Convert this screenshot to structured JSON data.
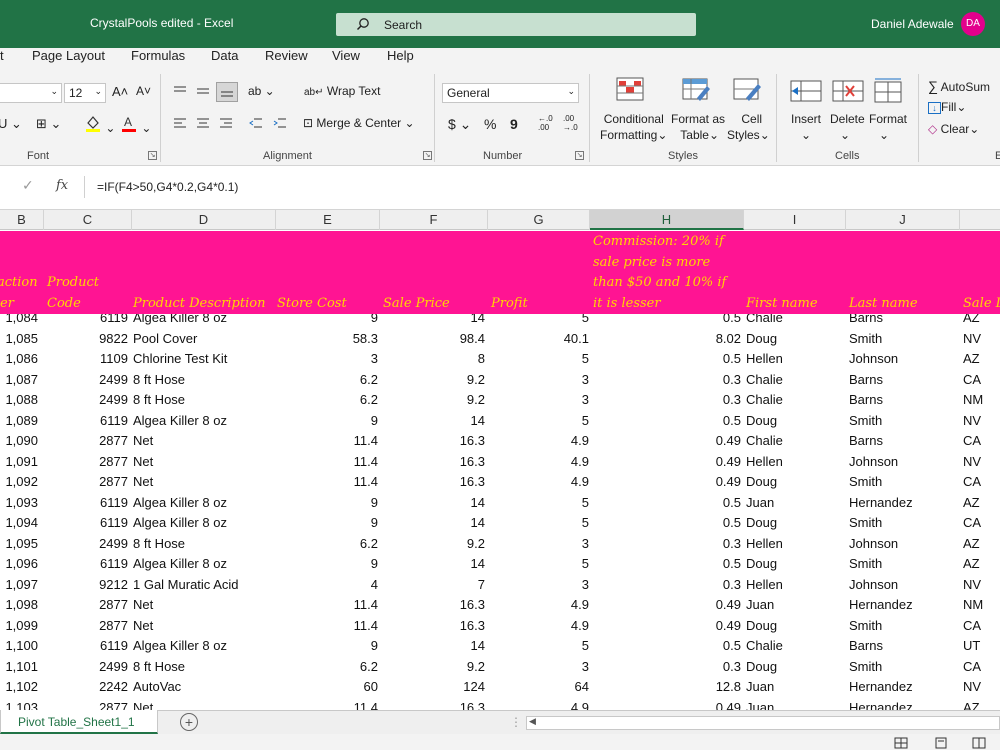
{
  "window": {
    "title": "CrystalPools edited  -  Excel",
    "search_label": "Search",
    "user_name": "Daniel Adewale",
    "user_initials": "DA"
  },
  "colors": {
    "brand": "#217346",
    "header_band": "#ff1493",
    "header_text": "#ffd700",
    "avatar": "#e3008c"
  },
  "tabs": {
    "t0": "t",
    "t1": "Page Layout",
    "t2": "Formulas",
    "t3": "Data",
    "t4": "Review",
    "t5": "View",
    "t6": "Help"
  },
  "ribbon": {
    "font_size": "12",
    "font_grow": "A˄",
    "font_shrink": "A˅",
    "wrap_text": "Wrap Text",
    "merge_center": "Merge & Center",
    "number_format": "General",
    "currency": "$",
    "percent": "%",
    "comma": "9",
    "inc_decimal": ".00",
    "dec_decimal": ".00",
    "cond_format_1": "Conditional",
    "cond_format_2": "Formatting",
    "format_table_1": "Format as",
    "format_table_2": "Table",
    "cell_styles_1": "Cell",
    "cell_styles_2": "Styles",
    "insert": "Insert",
    "delete": "Delete",
    "format": "Format",
    "autosum": "AutoSum",
    "fill": "Fill",
    "clear": "Clear",
    "groups": {
      "font": "Font",
      "alignment": "Alignment",
      "number": "Number",
      "styles": "Styles",
      "cells": "Cells",
      "editing": "E"
    }
  },
  "formula_bar": {
    "formula": "=IF(F4>50,G4*0.2,G4*0.1)"
  },
  "columns": [
    "B",
    "C",
    "D",
    "E",
    "F",
    "G",
    "H",
    "I",
    "J"
  ],
  "header_band": {
    "b_top": "action",
    "b_bot": "er",
    "c_top": "Product",
    "c_bot": "Code",
    "d": "Product Description",
    "e": "Store Cost",
    "f": "Sale Price",
    "g": "Profit",
    "h1": "Commission: 20% if",
    "h2": "sale price is more",
    "h3": "than $50 and 10% if",
    "h4": "it is lesser",
    "i": "First name",
    "j": "Last name",
    "k": "Sale L"
  },
  "rows": [
    {
      "b": "1,084",
      "c": "6119",
      "d": "Algea Killer 8 oz",
      "e": "9",
      "f": "14",
      "g": "5",
      "h": "0.5",
      "i": "Chalie",
      "j": "Barns",
      "k": "AZ"
    },
    {
      "b": "1,085",
      "c": "9822",
      "d": "Pool Cover",
      "e": "58.3",
      "f": "98.4",
      "g": "40.1",
      "h": "8.02",
      "i": "Doug",
      "j": "Smith",
      "k": "NV"
    },
    {
      "b": "1,086",
      "c": "1109",
      "d": "Chlorine Test Kit",
      "e": "3",
      "f": "8",
      "g": "5",
      "h": "0.5",
      "i": "Hellen",
      "j": "Johnson",
      "k": "AZ"
    },
    {
      "b": "1,087",
      "c": "2499",
      "d": "8 ft Hose",
      "e": "6.2",
      "f": "9.2",
      "g": "3",
      "h": "0.3",
      "i": "Chalie",
      "j": "Barns",
      "k": "CA"
    },
    {
      "b": "1,088",
      "c": "2499",
      "d": "8 ft Hose",
      "e": "6.2",
      "f": "9.2",
      "g": "3",
      "h": "0.3",
      "i": "Chalie",
      "j": "Barns",
      "k": "NM"
    },
    {
      "b": "1,089",
      "c": "6119",
      "d": "Algea Killer 8 oz",
      "e": "9",
      "f": "14",
      "g": "5",
      "h": "0.5",
      "i": "Doug",
      "j": "Smith",
      "k": "NV"
    },
    {
      "b": "1,090",
      "c": "2877",
      "d": "Net",
      "e": "11.4",
      "f": "16.3",
      "g": "4.9",
      "h": "0.49",
      "i": "Chalie",
      "j": "Barns",
      "k": "CA"
    },
    {
      "b": "1,091",
      "c": "2877",
      "d": "Net",
      "e": "11.4",
      "f": "16.3",
      "g": "4.9",
      "h": "0.49",
      "i": "Hellen",
      "j": "Johnson",
      "k": "NV"
    },
    {
      "b": "1,092",
      "c": "2877",
      "d": "Net",
      "e": "11.4",
      "f": "16.3",
      "g": "4.9",
      "h": "0.49",
      "i": "Doug",
      "j": "Smith",
      "k": "CA"
    },
    {
      "b": "1,093",
      "c": "6119",
      "d": "Algea Killer 8 oz",
      "e": "9",
      "f": "14",
      "g": "5",
      "h": "0.5",
      "i": "Juan",
      "j": "Hernandez",
      "k": "AZ"
    },
    {
      "b": "1,094",
      "c": "6119",
      "d": "Algea Killer 8 oz",
      "e": "9",
      "f": "14",
      "g": "5",
      "h": "0.5",
      "i": "Doug",
      "j": "Smith",
      "k": "CA"
    },
    {
      "b": "1,095",
      "c": "2499",
      "d": "8 ft Hose",
      "e": "6.2",
      "f": "9.2",
      "g": "3",
      "h": "0.3",
      "i": "Hellen",
      "j": "Johnson",
      "k": "AZ"
    },
    {
      "b": "1,096",
      "c": "6119",
      "d": "Algea Killer 8 oz",
      "e": "9",
      "f": "14",
      "g": "5",
      "h": "0.5",
      "i": "Doug",
      "j": "Smith",
      "k": "AZ"
    },
    {
      "b": "1,097",
      "c": "9212",
      "d": "1 Gal Muratic Acid",
      "e": "4",
      "f": "7",
      "g": "3",
      "h": "0.3",
      "i": "Hellen",
      "j": "Johnson",
      "k": "NV"
    },
    {
      "b": "1,098",
      "c": "2877",
      "d": "Net",
      "e": "11.4",
      "f": "16.3",
      "g": "4.9",
      "h": "0.49",
      "i": "Juan",
      "j": "Hernandez",
      "k": "NM"
    },
    {
      "b": "1,099",
      "c": "2877",
      "d": "Net",
      "e": "11.4",
      "f": "16.3",
      "g": "4.9",
      "h": "0.49",
      "i": "Doug",
      "j": "Smith",
      "k": "CA"
    },
    {
      "b": "1,100",
      "c": "6119",
      "d": "Algea Killer 8 oz",
      "e": "9",
      "f": "14",
      "g": "5",
      "h": "0.5",
      "i": "Chalie",
      "j": "Barns",
      "k": "UT"
    },
    {
      "b": "1,101",
      "c": "2499",
      "d": "8 ft Hose",
      "e": "6.2",
      "f": "9.2",
      "g": "3",
      "h": "0.3",
      "i": "Doug",
      "j": "Smith",
      "k": "CA"
    },
    {
      "b": "1,102",
      "c": "2242",
      "d": "AutoVac",
      "e": "60",
      "f": "124",
      "g": "64",
      "h": "12.8",
      "i": "Juan",
      "j": "Hernandez",
      "k": "NV"
    },
    {
      "b": "1,103",
      "c": "2877",
      "d": "Net",
      "e": "11.4",
      "f": "16.3",
      "g": "4.9",
      "h": "0.49",
      "i": "Juan",
      "j": "Hernandez",
      "k": "AZ"
    }
  ],
  "sheet_tabs": {
    "active": "Pivot Table_Sheet1_1"
  }
}
